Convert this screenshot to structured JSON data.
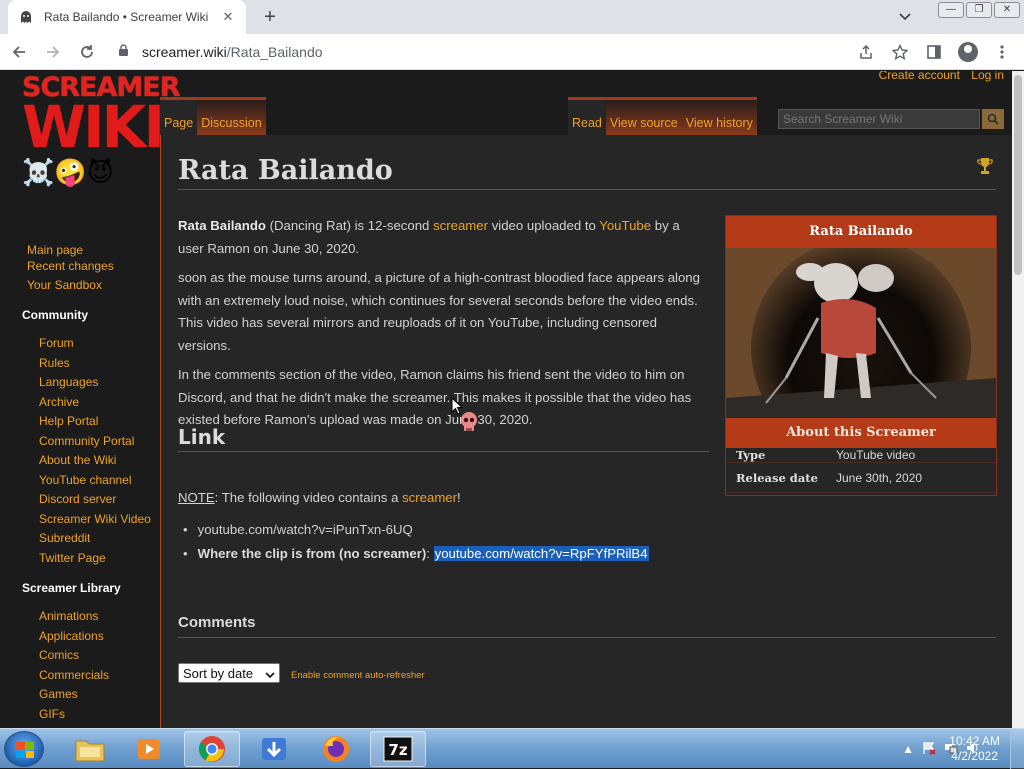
{
  "browser": {
    "tab_title": "Rata Bailando • Screamer Wiki",
    "tab_close": "✕",
    "new_tab": "+",
    "url_domain": "screamer.wiki",
    "url_path": "/Rata_Bailando"
  },
  "wiki": {
    "logo_line1": "SCREAMER",
    "logo_line2": "WIKI",
    "logo_emojis": "☠️🤪😈",
    "account": {
      "create": "Create account",
      "login": "Log in"
    },
    "tabs": {
      "page": "Page",
      "discussion": "Discussion",
      "read": "Read",
      "view_source": "View source",
      "view_history": "View history"
    },
    "search_placeholder": "Search Screamer Wiki",
    "sidebar": {
      "top": [
        "Main page",
        "Recent changes",
        "Your Sandbox"
      ],
      "community_heading": "Community",
      "community": [
        "Forum",
        "Rules",
        "Languages",
        "Archive",
        "Help Portal",
        "Community Portal",
        "About the Wiki",
        "YouTube channel",
        "Discord server",
        "Screamer Wiki Video",
        "Subreddit",
        "Twitter Page"
      ],
      "library_heading": "Screamer Library",
      "library": [
        "Animations",
        "Applications",
        "Comics",
        "Commercials",
        "Games",
        "GIFs"
      ]
    }
  },
  "article": {
    "title": "Rata Bailando",
    "p1_bold": "Rata Bailando",
    "p1_a": " (Dancing Rat) is 12-second ",
    "p1_link1": "screamer",
    "p1_b": " video uploaded to ",
    "p1_link2": "YouTube",
    "p1_c": " by a user Ramon on June 30, 2020.",
    "p2": "soon as the mouse turns around, a picture of a high-contrast bloodied face appears along with an extremely loud noise, which continues for several seconds before the video ends. This video has several mirrors and reuploads of it on YouTube, including censored versions.",
    "p3": "In the comments section of the video, Ramon claims his friend sent the video to him on Discord, and that he didn't make the screamer. This makes it possible that the video has existed before Ramon's upload was made on June 30, 2020.",
    "link_heading": "Link",
    "note_label": "NOTE",
    "note_text": ": The following video contains a ",
    "note_link": "screamer",
    "note_end": "!",
    "link1": "youtube.com/watch?v=iPunTxn-6UQ",
    "link2_label": "Where the clip is from (no screamer)",
    "link2_sep": ": ",
    "link2": "youtube.com/watch?v=RpFYfPRilB4",
    "comments_heading": "Comments",
    "sort_label": "Sort by date",
    "auto_refresh": "Enable comment auto-refresher"
  },
  "infobox": {
    "title": "Rata Bailando",
    "about": "About this Screamer",
    "rows": [
      {
        "k": "Type",
        "v": "YouTube video"
      },
      {
        "k": "Release date",
        "v": "June 30th, 2020"
      }
    ]
  },
  "taskbar": {
    "time": "10:42 AM",
    "date": "4/2/2022"
  }
}
